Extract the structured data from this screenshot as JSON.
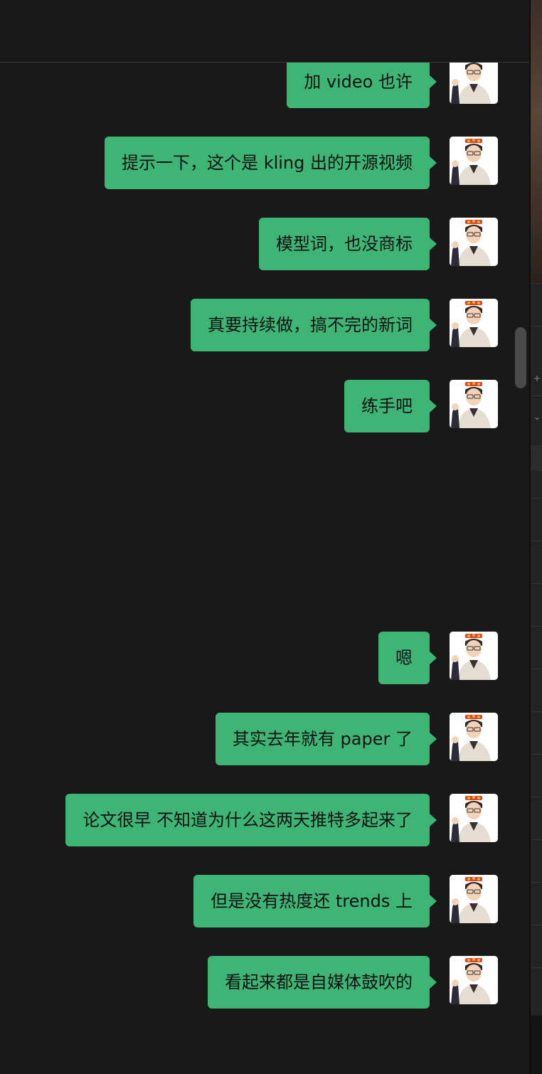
{
  "messages": [
    {
      "text": "加 video 也许"
    },
    {
      "text": "提示一下，这个是 kling 出的开源视频"
    },
    {
      "text": "模型词，也没商标"
    },
    {
      "text": "真要持续做，搞不完的新词"
    },
    {
      "text": "练手吧"
    },
    {
      "text": "嗯"
    },
    {
      "text": "其实去年就有 paper 了"
    },
    {
      "text": "论文很早 不知道为什么这两天推特多起来了"
    },
    {
      "text": "但是没有热度还 trends 上"
    },
    {
      "text": "看起来都是自媒体鼓吹的"
    }
  ],
  "colors": {
    "background": "#191919",
    "bubble": "#3eb575",
    "bubble_text": "#111111"
  },
  "icons": {
    "avatar": "avatar-cartoon-person-icon",
    "sidebar_plus": "plus-icon",
    "sidebar_chevron": "chevron-down-icon"
  }
}
